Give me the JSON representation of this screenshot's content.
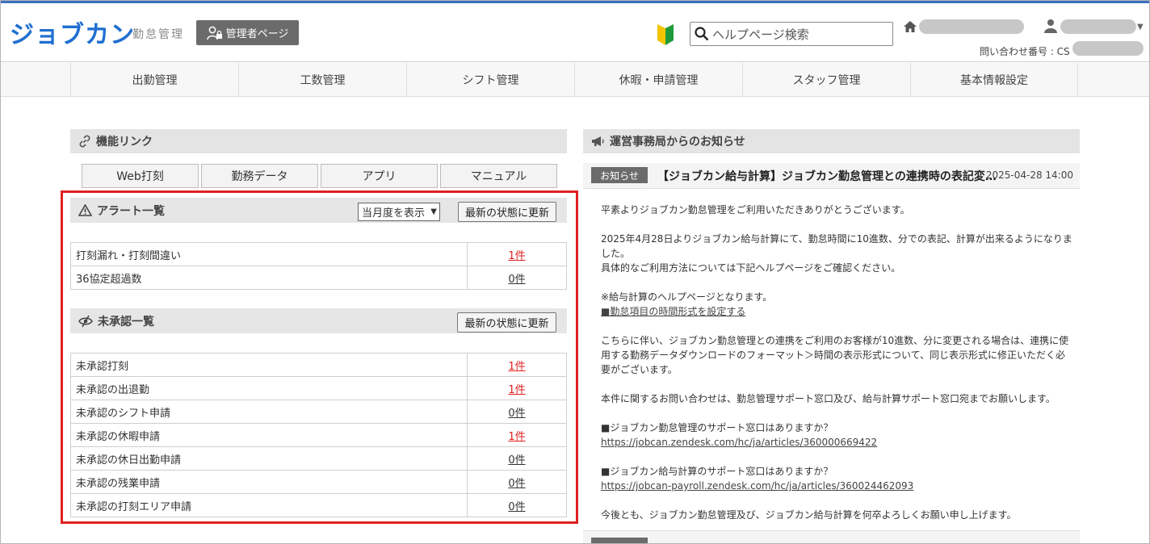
{
  "header": {
    "logo": "ジョブカン",
    "logo_sub": "勤怠管理",
    "admin_button": "管理者ページ",
    "search_placeholder": "ヘルプページ検索",
    "inquiry_label": "問い合わせ番号 : CS"
  },
  "nav": {
    "items": [
      "出勤管理",
      "工数管理",
      "シフト管理",
      "休暇・申請管理",
      "スタッフ管理",
      "基本情報設定"
    ]
  },
  "links": {
    "title": "機能リンク",
    "tabs": [
      "Web打刻",
      "勤務データ",
      "アプリ",
      "マニュアル"
    ]
  },
  "alerts": {
    "title": "アラート一覧",
    "period_select": "当月度を表示",
    "refresh_label": "最新の状態に更新",
    "rows": [
      {
        "label": "打刻漏れ・打刻間違い",
        "count": "1件",
        "highlight": true
      },
      {
        "label": "36協定超過数",
        "count": "0件",
        "highlight": false
      }
    ]
  },
  "unapproved": {
    "title": "未承認一覧",
    "refresh_label": "最新の状態に更新",
    "rows": [
      {
        "label": "未承認打刻",
        "count": "1件",
        "highlight": true
      },
      {
        "label": "未承認の出退勤",
        "count": "1件",
        "highlight": true
      },
      {
        "label": "未承認のシフト申請",
        "count": "0件",
        "highlight": false
      },
      {
        "label": "未承認の休暇申請",
        "count": "1件",
        "highlight": true
      },
      {
        "label": "未承認の休日出勤申請",
        "count": "0件",
        "highlight": false
      },
      {
        "label": "未承認の残業申請",
        "count": "0件",
        "highlight": false
      },
      {
        "label": "未承認の打刻エリア申請",
        "count": "0件",
        "highlight": false
      }
    ]
  },
  "news": {
    "title": "運営事務局からのお知らせ",
    "badge": "お知らせ",
    "item_title": "【ジョブカン給与計算】ジョブカン勤怠管理との連携時の表記変更について",
    "item_date": "2025-04-28 14:00",
    "body": {
      "l1": "平素よりジョブカン勤怠管理をご利用いただきありがとうございます。",
      "l2": "2025年4月28日よりジョブカン給与計算にて、勤怠時間に10進数、分での表記、計算が出来るようになりました。",
      "l3": "具体的なご利用方法については下記ヘルプページをご確認ください。",
      "l4": "※給与計算のヘルプページとなります。",
      "l5": "■勤怠項目の時間形式を設定する",
      "l6": "こちらに伴い、ジョブカン勤怠管理との連携をご利用のお客様が10進数、分に変更される場合は、連携に使用する勤務データダウンロードのフォーマット＞時間の表示形式について、同じ表示形式に修正いただく必要がございます。",
      "l7": "本件に関するお問い合わせは、勤怠管理サポート窓口及び、給与計算サポート窓口宛までお願いします。",
      "l8": "■ジョブカン勤怠管理のサポート窓口はありますか？",
      "l9": "https://jobcan.zendesk.com/hc/ja/articles/360000669422",
      "l10": "■ジョブカン給与計算のサポート窓口はありますか？",
      "l11": "https://jobcan-payroll.zendesk.com/hc/ja/articles/360024462093",
      "l12": "今後とも、ジョブカン勤怠管理及び、ジョブカン給与計算を何卒よろしくお願い申し上げます。"
    }
  },
  "colors": {
    "brand": "#1f6fd0",
    "alert": "#e02020",
    "topline": "#3d6fbf"
  }
}
